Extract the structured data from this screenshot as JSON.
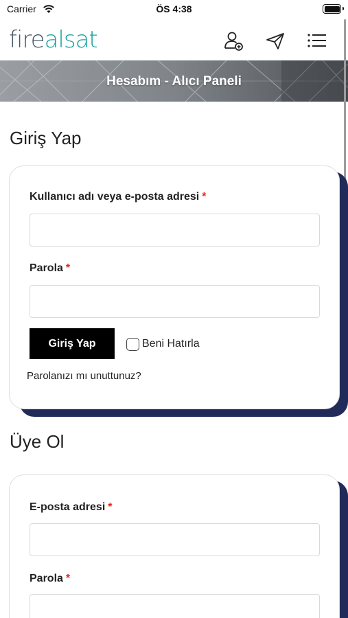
{
  "status_bar": {
    "carrier": "Carrier",
    "time": "ÖS 4:38"
  },
  "header": {
    "logo_part1": "fire",
    "logo_part2": "alsat",
    "icons": [
      "user-add-icon",
      "send-icon",
      "hamburger-menu-icon"
    ]
  },
  "hero": {
    "title": "Hesabım - Alıcı Paneli"
  },
  "login": {
    "title": "Giriş Yap",
    "username_label": "Kullanıcı adı veya e-posta adresi",
    "password_label": "Parola",
    "required_mark": "*",
    "username_value": "",
    "password_value": "",
    "submit_label": "Giriş Yap",
    "remember_label": "Beni Hatırla",
    "remember_checked": false,
    "lost_password": "Parolanızı mı unuttunuz?"
  },
  "register": {
    "title": "Üye Ol",
    "email_label": "E-posta adresi",
    "password_label": "Parola",
    "required_mark": "*",
    "email_value": "",
    "password_value": ""
  },
  "colors": {
    "accent": "#17a2a0",
    "card_shadow": "#212b5a",
    "required": "#e0261f",
    "button": "#000000"
  }
}
